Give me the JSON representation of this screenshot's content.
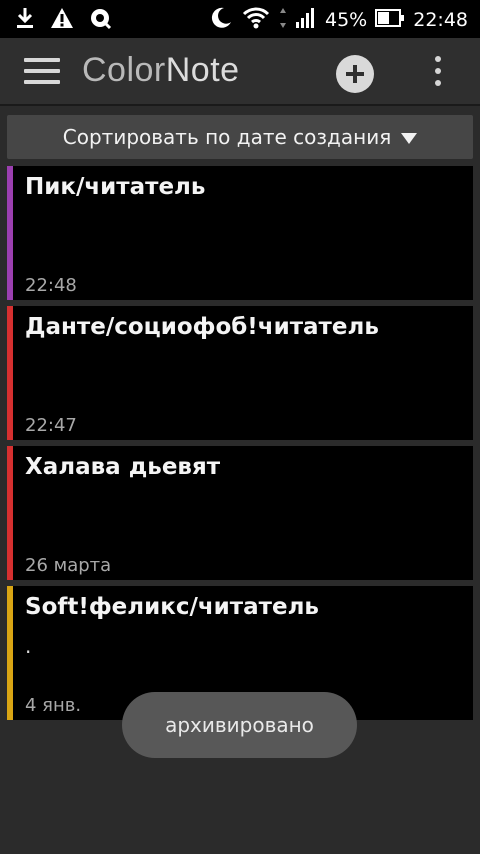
{
  "status_bar": {
    "battery_percent": "45%",
    "time": "22:48",
    "icons": [
      "download-icon",
      "warning-icon",
      "sync-icon",
      "moon-icon",
      "wifi-icon",
      "signal-icon",
      "battery-icon"
    ]
  },
  "app_bar": {
    "title_part1": "Color",
    "title_part2": "Note"
  },
  "sort": {
    "label": "Сортировать по дате создания"
  },
  "notes": [
    {
      "title": "Пик/читатель",
      "body": "",
      "date": "22:48",
      "color": "#9b3fb0"
    },
    {
      "title": "Данте/социофоб!читатель",
      "body": "",
      "date": "22:47",
      "color": "#d63030"
    },
    {
      "title": "Халава дьевят",
      "body": "",
      "date": "26 марта",
      "color": "#d63030"
    },
    {
      "title": "Soft!феликс/читатель",
      "body": ".",
      "date": "4 янв.",
      "color": "#d9a514"
    }
  ],
  "toast": {
    "text": "архивировано"
  }
}
